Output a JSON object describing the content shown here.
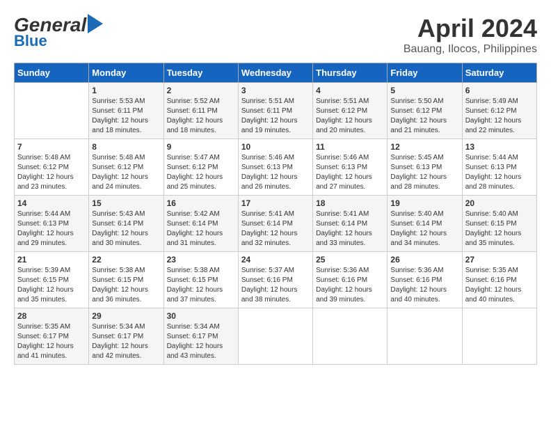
{
  "header": {
    "logo_top": "General",
    "logo_bottom": "Blue",
    "title": "April 2024",
    "subtitle": "Bauang, Ilocos, Philippines"
  },
  "calendar": {
    "days_of_week": [
      "Sunday",
      "Monday",
      "Tuesday",
      "Wednesday",
      "Thursday",
      "Friday",
      "Saturday"
    ],
    "weeks": [
      [
        {
          "day": "",
          "info": ""
        },
        {
          "day": "1",
          "info": "Sunrise: 5:53 AM\nSunset: 6:11 PM\nDaylight: 12 hours\nand 18 minutes."
        },
        {
          "day": "2",
          "info": "Sunrise: 5:52 AM\nSunset: 6:11 PM\nDaylight: 12 hours\nand 18 minutes."
        },
        {
          "day": "3",
          "info": "Sunrise: 5:51 AM\nSunset: 6:11 PM\nDaylight: 12 hours\nand 19 minutes."
        },
        {
          "day": "4",
          "info": "Sunrise: 5:51 AM\nSunset: 6:12 PM\nDaylight: 12 hours\nand 20 minutes."
        },
        {
          "day": "5",
          "info": "Sunrise: 5:50 AM\nSunset: 6:12 PM\nDaylight: 12 hours\nand 21 minutes."
        },
        {
          "day": "6",
          "info": "Sunrise: 5:49 AM\nSunset: 6:12 PM\nDaylight: 12 hours\nand 22 minutes."
        }
      ],
      [
        {
          "day": "7",
          "info": "Sunrise: 5:48 AM\nSunset: 6:12 PM\nDaylight: 12 hours\nand 23 minutes."
        },
        {
          "day": "8",
          "info": "Sunrise: 5:48 AM\nSunset: 6:12 PM\nDaylight: 12 hours\nand 24 minutes."
        },
        {
          "day": "9",
          "info": "Sunrise: 5:47 AM\nSunset: 6:12 PM\nDaylight: 12 hours\nand 25 minutes."
        },
        {
          "day": "10",
          "info": "Sunrise: 5:46 AM\nSunset: 6:13 PM\nDaylight: 12 hours\nand 26 minutes."
        },
        {
          "day": "11",
          "info": "Sunrise: 5:46 AM\nSunset: 6:13 PM\nDaylight: 12 hours\nand 27 minutes."
        },
        {
          "day": "12",
          "info": "Sunrise: 5:45 AM\nSunset: 6:13 PM\nDaylight: 12 hours\nand 28 minutes."
        },
        {
          "day": "13",
          "info": "Sunrise: 5:44 AM\nSunset: 6:13 PM\nDaylight: 12 hours\nand 28 minutes."
        }
      ],
      [
        {
          "day": "14",
          "info": "Sunrise: 5:44 AM\nSunset: 6:13 PM\nDaylight: 12 hours\nand 29 minutes."
        },
        {
          "day": "15",
          "info": "Sunrise: 5:43 AM\nSunset: 6:14 PM\nDaylight: 12 hours\nand 30 minutes."
        },
        {
          "day": "16",
          "info": "Sunrise: 5:42 AM\nSunset: 6:14 PM\nDaylight: 12 hours\nand 31 minutes."
        },
        {
          "day": "17",
          "info": "Sunrise: 5:41 AM\nSunset: 6:14 PM\nDaylight: 12 hours\nand 32 minutes."
        },
        {
          "day": "18",
          "info": "Sunrise: 5:41 AM\nSunset: 6:14 PM\nDaylight: 12 hours\nand 33 minutes."
        },
        {
          "day": "19",
          "info": "Sunrise: 5:40 AM\nSunset: 6:14 PM\nDaylight: 12 hours\nand 34 minutes."
        },
        {
          "day": "20",
          "info": "Sunrise: 5:40 AM\nSunset: 6:15 PM\nDaylight: 12 hours\nand 35 minutes."
        }
      ],
      [
        {
          "day": "21",
          "info": "Sunrise: 5:39 AM\nSunset: 6:15 PM\nDaylight: 12 hours\nand 35 minutes."
        },
        {
          "day": "22",
          "info": "Sunrise: 5:38 AM\nSunset: 6:15 PM\nDaylight: 12 hours\nand 36 minutes."
        },
        {
          "day": "23",
          "info": "Sunrise: 5:38 AM\nSunset: 6:15 PM\nDaylight: 12 hours\nand 37 minutes."
        },
        {
          "day": "24",
          "info": "Sunrise: 5:37 AM\nSunset: 6:16 PM\nDaylight: 12 hours\nand 38 minutes."
        },
        {
          "day": "25",
          "info": "Sunrise: 5:36 AM\nSunset: 6:16 PM\nDaylight: 12 hours\nand 39 minutes."
        },
        {
          "day": "26",
          "info": "Sunrise: 5:36 AM\nSunset: 6:16 PM\nDaylight: 12 hours\nand 40 minutes."
        },
        {
          "day": "27",
          "info": "Sunrise: 5:35 AM\nSunset: 6:16 PM\nDaylight: 12 hours\nand 40 minutes."
        }
      ],
      [
        {
          "day": "28",
          "info": "Sunrise: 5:35 AM\nSunset: 6:17 PM\nDaylight: 12 hours\nand 41 minutes."
        },
        {
          "day": "29",
          "info": "Sunrise: 5:34 AM\nSunset: 6:17 PM\nDaylight: 12 hours\nand 42 minutes."
        },
        {
          "day": "30",
          "info": "Sunrise: 5:34 AM\nSunset: 6:17 PM\nDaylight: 12 hours\nand 43 minutes."
        },
        {
          "day": "",
          "info": ""
        },
        {
          "day": "",
          "info": ""
        },
        {
          "day": "",
          "info": ""
        },
        {
          "day": "",
          "info": ""
        }
      ]
    ]
  }
}
